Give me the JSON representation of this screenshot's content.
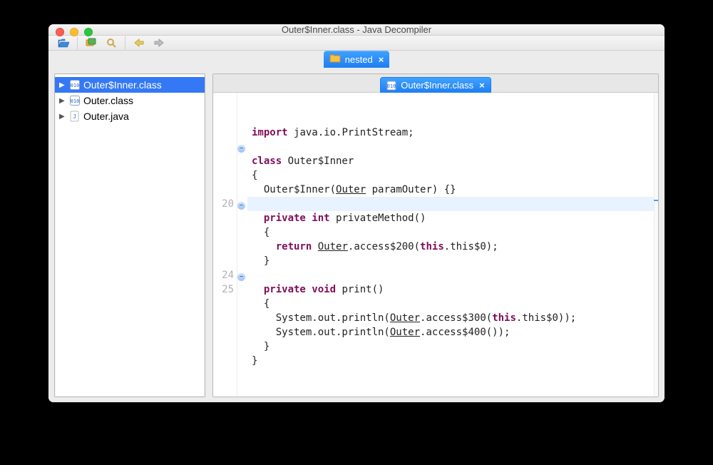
{
  "window_title": "Outer$Inner.class - Java Decompiler",
  "project_tab": {
    "label": "nested"
  },
  "tree": {
    "items": [
      {
        "label": "Outer$Inner.class",
        "icon": "class-file-icon",
        "selected": true
      },
      {
        "label": "Outer.class",
        "icon": "class-file-icon",
        "selected": false
      },
      {
        "label": "Outer.java",
        "icon": "java-file-icon",
        "selected": false
      }
    ]
  },
  "editor_tab": {
    "label": "Outer$Inner.class"
  },
  "gutter_line_numbers": [
    "",
    "",
    "",
    "",
    "",
    "",
    "",
    "20",
    "",
    "",
    "",
    "",
    "24",
    "25",
    "",
    ""
  ],
  "fold_markers": {
    "3": true,
    "7": true,
    "12": true
  },
  "highlight_line_index": 7,
  "code_tokens": [
    [
      {
        "t": "import ",
        "c": "kw"
      },
      {
        "t": "java.io.PrintStream;"
      }
    ],
    [
      {
        "t": ""
      }
    ],
    [
      {
        "t": "class ",
        "c": "kw"
      },
      {
        "t": "Outer$Inner"
      }
    ],
    [
      {
        "t": "{"
      }
    ],
    [
      {
        "t": "  Outer$Inner("
      },
      {
        "t": "Outer",
        "c": "linkish"
      },
      {
        "t": " paramOuter) {}"
      }
    ],
    [
      {
        "t": "  "
      }
    ],
    [
      {
        "t": "  "
      },
      {
        "t": "private int ",
        "c": "kw"
      },
      {
        "t": "privateMethod()"
      }
    ],
    [
      {
        "t": "  {"
      }
    ],
    [
      {
        "t": "    "
      },
      {
        "t": "return ",
        "c": "kw"
      },
      {
        "t": "Outer",
        "c": "linkish"
      },
      {
        "t": ".access$200("
      },
      {
        "t": "this",
        "c": "kw"
      },
      {
        "t": ".this$0);"
      }
    ],
    [
      {
        "t": "  }"
      }
    ],
    [
      {
        "t": "  "
      }
    ],
    [
      {
        "t": "  "
      },
      {
        "t": "private void ",
        "c": "kw"
      },
      {
        "t": "print()"
      }
    ],
    [
      {
        "t": "  {"
      }
    ],
    [
      {
        "t": "    System.out.println("
      },
      {
        "t": "Outer",
        "c": "linkish"
      },
      {
        "t": ".access$300("
      },
      {
        "t": "this",
        "c": "kw"
      },
      {
        "t": ".this$0));"
      }
    ],
    [
      {
        "t": "    System.out.println("
      },
      {
        "t": "Outer",
        "c": "linkish"
      },
      {
        "t": ".access$400());"
      }
    ],
    [
      {
        "t": "  }"
      }
    ],
    [
      {
        "t": "}"
      }
    ]
  ],
  "toolbar": {
    "open_label": "Open",
    "open_folder_label": "Open Folder",
    "search_label": "Search",
    "back_label": "Back",
    "forward_label": "Forward"
  }
}
